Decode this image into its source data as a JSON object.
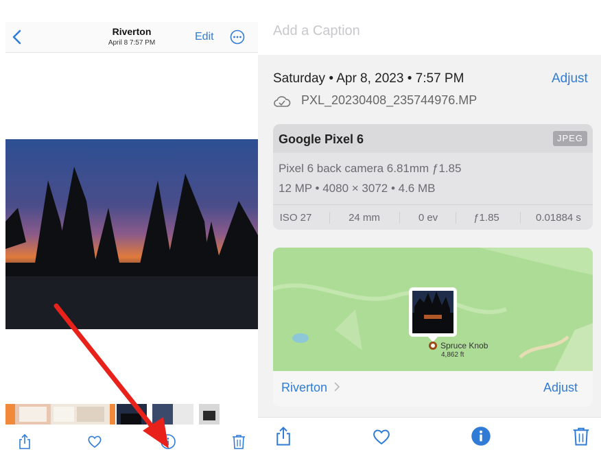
{
  "viewer": {
    "back_icon": "chevron-left-icon",
    "title": "Riverton",
    "subtitle": "April 8  7:57 PM",
    "edit_label": "Edit",
    "more_icon": "ellipsis-circle-icon"
  },
  "viewer_toolbar": [
    "share-icon",
    "heart-icon",
    "info-icon",
    "trash-icon"
  ],
  "info": {
    "caption_placeholder": "Add a Caption",
    "date": "Saturday • Apr 8, 2023 • 7:57 PM",
    "adjust_label": "Adjust",
    "cloud_icon": "cloud-check-icon",
    "filename": "PXL_20230408_235744976.MP",
    "camera": {
      "model": "Google Pixel 6",
      "format": "JPEG",
      "lens": "Pixel 6 back camera 6.81mm ƒ1.85",
      "specs": "12 MP • 4080 × 3072 • 4.6 MB",
      "exif": [
        "ISO 27",
        "24 mm",
        "0 ev",
        "ƒ1.85",
        "0.01884 s"
      ]
    },
    "map": {
      "place": "Riverton",
      "place_chevron": "chevron-right-icon",
      "adjust_label": "Adjust",
      "pin_label": "Spruce Knob",
      "pin_elevation": "4,862 ft"
    }
  },
  "info_toolbar": [
    "share-icon",
    "heart-icon",
    "info-filled-icon",
    "trash-icon"
  ],
  "colors": {
    "accent": "#2f7bd6",
    "map_green": "#acdc95",
    "panel_gray": "#f2f2f3"
  }
}
